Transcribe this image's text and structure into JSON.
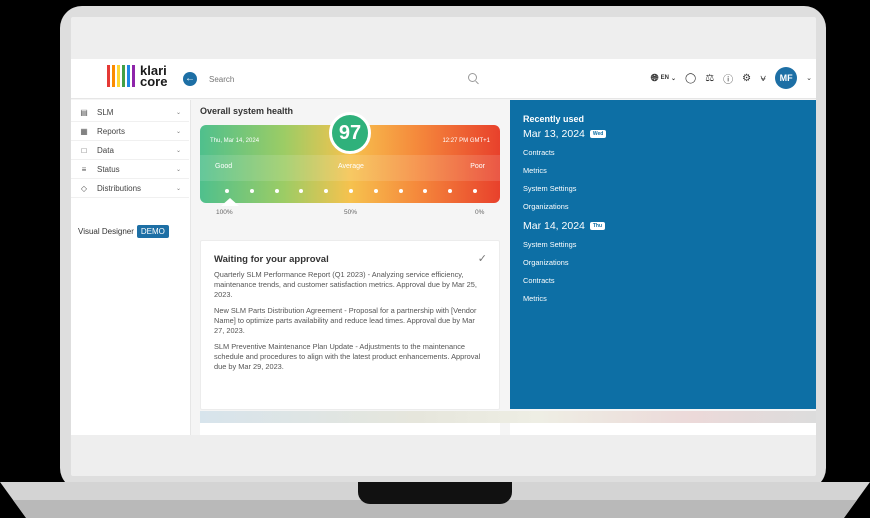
{
  "brand": {
    "logo_text_1": "klari",
    "logo_text_2": "core",
    "bar_colors": [
      "#e53935",
      "#fb8c00",
      "#fdd835",
      "#43a047",
      "#1e88e5",
      "#8e24aa"
    ]
  },
  "header": {
    "search_placeholder": "Search",
    "language": "EN",
    "avatar_initials": "MF"
  },
  "sidebar": {
    "items": [
      {
        "label": "SLM",
        "icon": "book-icon"
      },
      {
        "label": "Reports",
        "icon": "report-icon"
      },
      {
        "label": "Data",
        "icon": "folder-icon"
      },
      {
        "label": "Status",
        "icon": "status-icon"
      },
      {
        "label": "Distributions",
        "icon": "diamond-icon"
      }
    ],
    "visual_designer_label": "Visual Designer",
    "demo_label": "DEMO"
  },
  "health": {
    "title": "Overall system health",
    "score": "97",
    "date": "Thu, Mar 14, 2024",
    "time": "12:27 PM GMT+1",
    "label_good": "Good",
    "label_average": "Average",
    "label_poor": "Poor",
    "pct_100": "100%",
    "pct_50": "50%",
    "pct_0": "0%"
  },
  "approval": {
    "title": "Waiting for your approval",
    "items": [
      "Quarterly SLM Performance Report (Q1 2023) - Analyzing service efficiency, maintenance trends, and customer satisfaction metrics. Approval due by Mar 25, 2023.",
      "New SLM Parts Distribution Agreement - Proposal for a partnership with [Vendor Name] to optimize parts availability and reduce lead times. Approval due by Mar 27, 2023.",
      "SLM Preventive Maintenance Plan Update - Adjustments to the maintenance schedule and procedures to align with the latest product enhancements. Approval due by Mar 29, 2023."
    ]
  },
  "recent": {
    "title": "Recently used",
    "groups": [
      {
        "date": "Mar 13, 2024",
        "day": "Wed",
        "links": [
          "Contracts",
          "Metrics",
          "System Settings",
          "Organizations"
        ]
      },
      {
        "date": "Mar 14, 2024",
        "day": "Thu",
        "links": [
          "System Settings",
          "Organizations",
          "Contracts",
          "Metrics"
        ]
      }
    ]
  },
  "colors": {
    "accent": "#0d6fa5",
    "score_green": "#2fb17b"
  }
}
